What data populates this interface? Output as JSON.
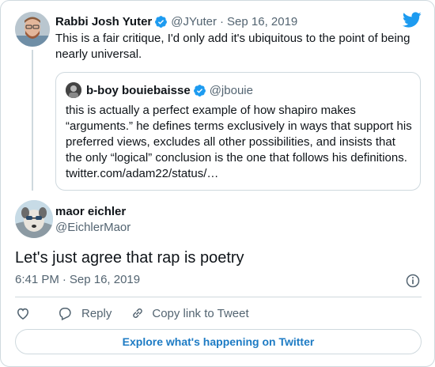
{
  "parent_tweet": {
    "author_name": "Rabbi Josh Yuter",
    "handle": "@JYuter",
    "separator": "·",
    "date": "Sep 16, 2019",
    "text": "This is a fair critique, I'd only add it's ubiquitous to the point of being nearly universal.",
    "verified_icon": "verified-badge-icon",
    "avatar_icon": "avatar"
  },
  "quoted_tweet": {
    "author_name": "b-boy bouiebaisse",
    "handle": "@jbouie",
    "text": "this is actually a perfect example of how shapiro makes “arguments.” he defines terms exclusively in ways that support his preferred views, excludes all other possibilities, and insists that the only “logical” conclusion is the one that follows his definitions. twitter.com/adam22/status/…",
    "verified_icon": "verified-badge-icon"
  },
  "main_tweet": {
    "author_name": "maor eichler",
    "handle": "@EichlerMaor",
    "text": "Let's just agree that rap is poetry",
    "time": "6:41 PM",
    "separator": "·",
    "date": "Sep 16, 2019"
  },
  "actions": {
    "like_icon": "heart-icon",
    "reply_label": "Reply",
    "reply_icon": "reply-icon",
    "copy_link_label": "Copy link to Tweet",
    "copy_link_icon": "link-icon"
  },
  "explore_button_label": "Explore what's happening on Twitter",
  "colors": {
    "twitter_blue": "#1d9bf0",
    "explore_text": "#1d7bc4",
    "secondary_text": "#536471",
    "border": "#cfd9de"
  }
}
